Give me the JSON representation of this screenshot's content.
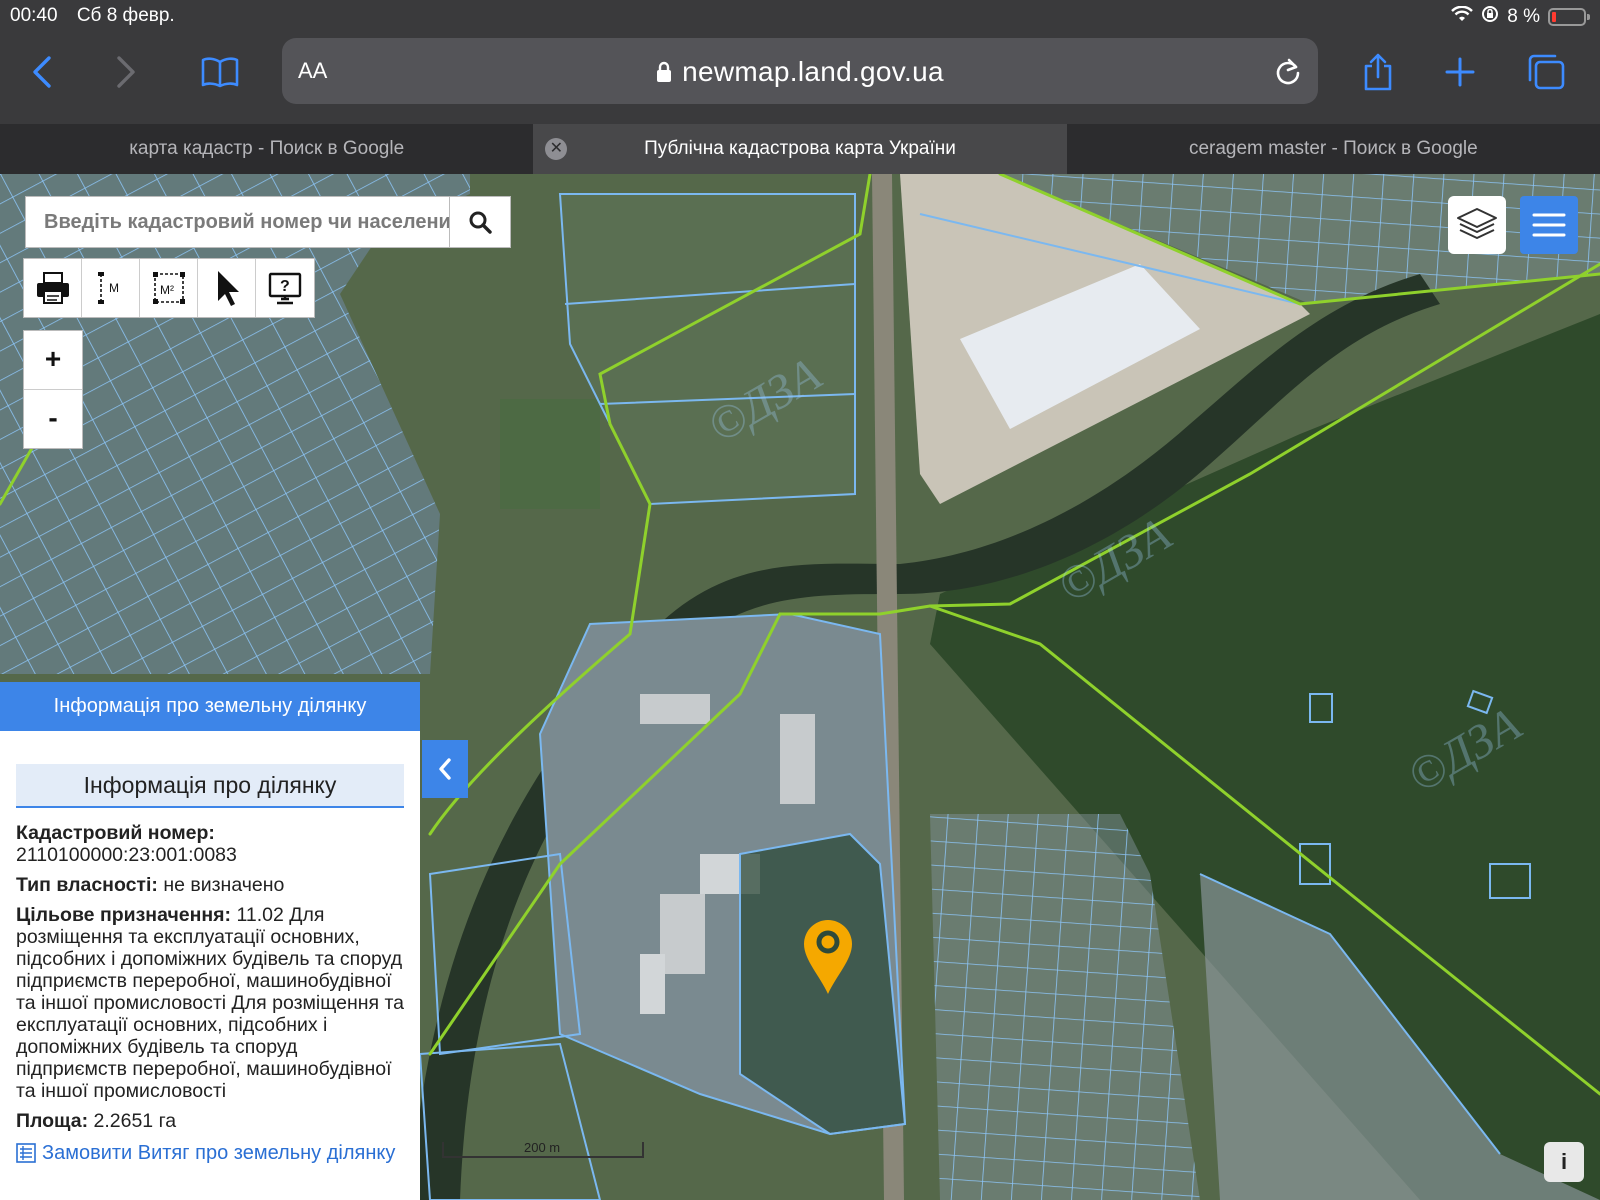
{
  "status": {
    "time": "00:40",
    "date": "Сб 8 февр.",
    "battery": "8 %"
  },
  "browser": {
    "text_size_label": "AA",
    "url": "newmap.land.gov.ua",
    "tabs": [
      {
        "title": "карта кадастр - Поиск в Google"
      },
      {
        "title": "Публічна кадастрова карта України"
      },
      {
        "title": "ceragem master - Поиск в Google"
      }
    ]
  },
  "map": {
    "search_placeholder": "Введіть кадастровий номер чи населений",
    "zoom_in": "+",
    "zoom_out": "-",
    "scale_label": "200 m",
    "info_button": "i",
    "measure_line_label": "M",
    "measure_area_label": "M²"
  },
  "panel": {
    "header": "Інформація про земельну ділянку",
    "subheader": "Інформація про ділянку",
    "cadastral_label": "Кадастровий номер:",
    "cadastral_value": "2110100000:23:001:0083",
    "ownership_label": "Тип власності:",
    "ownership_value": " не визначено",
    "purpose_label": "Цільове призначення:",
    "purpose_value": " 11.02 Для розміщення та експлуатації основних, підсобних і допоміжних будівель та споруд підприємств переробної, машинобудівної та іншої промисловості Для розміщення та експлуатації основних, підсобних і допоміжних будівель та споруд підприємств переробної, машинобудівної та іншої промисловості",
    "area_label": "Площа:",
    "area_value": " 2.2651 га",
    "order_link": "Замовити Витяг про земельну ділянку"
  },
  "colors": {
    "accent": "#3d85e8",
    "marker": "#f5a800",
    "parcel_line": "#7bb8f0",
    "boundary_line": "#8fd12c"
  }
}
